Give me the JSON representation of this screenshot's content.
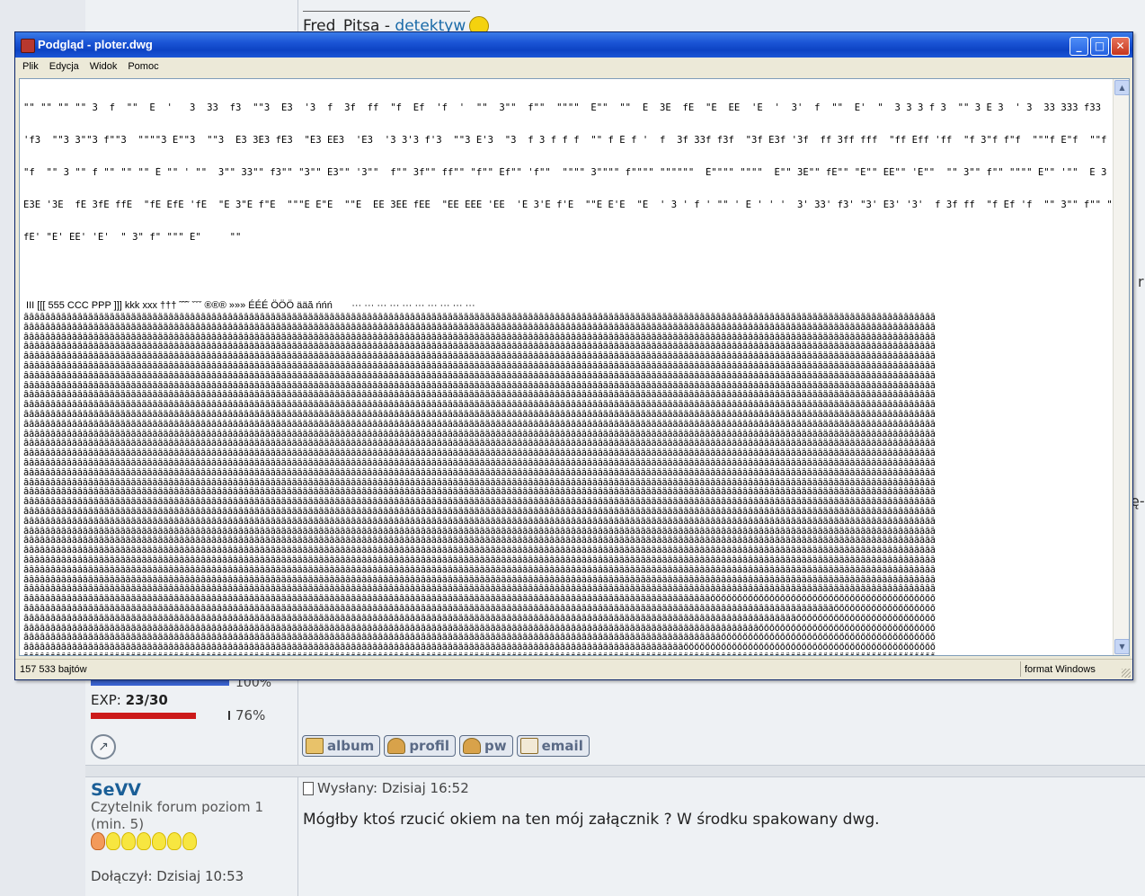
{
  "forum": {
    "signature_name": "Fred_Pitsa",
    "signature_sep": " - ",
    "signature_link": "detektyw",
    "hp_percent_label": "100%",
    "hp_fraction": 1.0,
    "exp_label": "EXP:",
    "exp_value": "23/30",
    "exp_percent_label": "76%",
    "exp_fraction": 0.76,
    "buttons": {
      "album": "album",
      "profil": "profil",
      "pw": "pw",
      "email": "email"
    },
    "next_post": {
      "user_name": "SeVV",
      "rank": "Czytelnik forum poziom 1 (min. 5)",
      "joined": "Dołączył: Dzisiaj 10:53",
      "posted": "Wysłany: Dzisiaj 16:52",
      "text": "Mógłby ktoś rzucić okiem na ten mój załącznik ? W środku spakowany dwg."
    },
    "edge_glyph_1": "r",
    "edge_glyph_2": "ę-"
  },
  "window": {
    "title": "Podgląd - ploter.dwg",
    "menu": [
      "Plik",
      "Edycja",
      "Widok",
      "Pomoc"
    ],
    "garbage_lines": [
      "\"\" \"\" \"\" \"\" 3  f  \"\"  Ĕ  '   3  33  f3  \"\"3  Ĕ3  '3  f  3f  ff  \"f  Ĕf  'f  '  \"\"  3\"\"  f\"\"  \"\"\"\"  Ĕ\"\"  \"\"  Ĕ  3Ĕ  fĔ  \"Ĕ  ĔĔ  'Ĕ  '  3'  f  \"\"  Ĕ'  \"  3 3 3 f 3  \"\" 3 Ĕ 3  ' 3  33 333 f33  \"\"33 Ĕ33  '33  f3 3f3 ff3  \"f3 Ĕf3",
      "'f3  \"\"3 3\"\"3 f\"\"3  \"\"\"\"3 Ĕ\"\"3  \"\"3  Ĕ3 3Ĕ3 fĔ3  \"Ĕ3 ĔĔ3  'Ĕ3  '3 3'3 f'3  \"\"3 Ĕ'3  \"3  f 3 f f f  \"\" f Ĕ f '  f  3f 33f f3f  \"3f Ĕ3f '3f  ff 3ff fff  \"ff Ĕff 'ff  \"f 3\"f f\"f  \"\"\"f Ĕ\"f  \"\"f  Ĕf 3Ĕf fĔf \"Ĕf ĔĔf 'Ĕf  'f 3'f f'f  \"\"f Ĕ'f",
      "\"f  \"\" 3 \"\" f \"\" \"\" \"\" Ĕ \"\" ' \"\"  3\"\" 33\"\" f3\"\" \"3\"\" Ĕ3\"\" '3\"\"  f\"\" 3f\"\" ff\"\" \"f\"\" Ĕf\"\" 'f\"\"  \"\"\"\" 3\"\"\"\" f\"\"\"\" \"\"\"\"\"\"  Ĕ\"\"\"\" \"\"\"\"  Ĕ\"\" 3Ĕ\"\" fĔ\"\" \"Ĕ\"\" ĔĔ\"\" 'Ĕ\"\"  \"\" 3\"\" f\"\" \"\"\"\" Ĕ\"\" '\"\"  Ĕ 3 Ĕ f Ĕ  \"\" Ĕ Ĕ Ĕ ' Ĕ  3Ĕ 33Ĕ f3Ĕ  \"3Ĕ",
      "Ĕ3Ĕ '3Ĕ  fĔ 3fĔ ffĔ  \"fĔ ĔfĔ 'fĔ  \"Ĕ 3\"Ĕ f\"Ĕ  \"\"\"Ĕ Ĕ\"Ĕ  \"\"Ĕ  ĔĔ 3ĔĔ fĔĔ  \"ĔĔ ĔĔĔ 'ĔĔ  'Ĕ 3'Ĕ f'Ĕ  \"\"Ĕ Ĕ'Ĕ  \"Ĕ  ' 3 ' f ' \"\" ' Ĕ ' ' '  3' 33' f3' \"3' Ĕ3' '3'  f 3f ff  \"f Ĕf 'f  \"\" 3\"\" f\"\" \"\"\"\" Ĕ\"\" '\"\"  Ĕ' 3Ĕ'",
      "fĔ' \"Ĕ' ĔĔ' 'Ĕ'  \" 3\" f\" \"\"\" Ĕ\"     \"\""
    ],
    "glyph_line": " III [[[ 555 CCC PPP ]]] kkk xxx ††† ˜˜˜ ˇˇˇ ®®® »»» ÉÉÉ ÖÖÖ ääă ńńń       ··· ··· ··· ··· ··· ··· ··· ··· ··· ···",
    "status_size": "157 533 bajtów",
    "status_format": "format Windows"
  }
}
